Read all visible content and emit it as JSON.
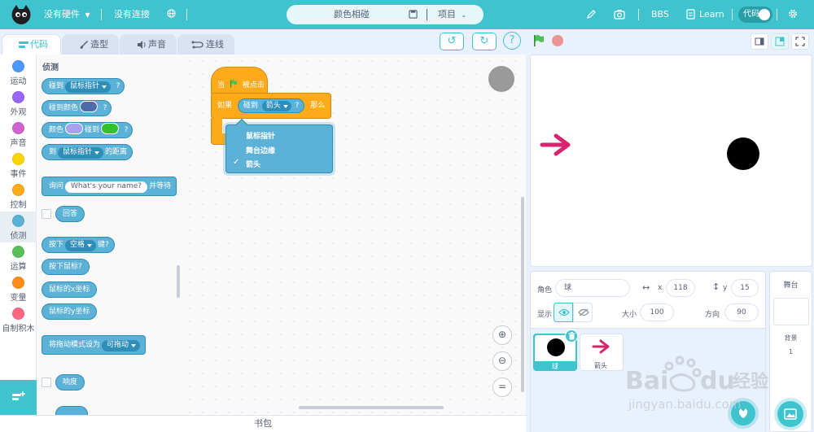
{
  "topbar": {
    "hardware": "没有硬件",
    "connection": "没有连接",
    "project_title": "颜色相碰",
    "project_menu": "项目",
    "bbs": "BBS",
    "learn": "Learn",
    "code_toggle": "代码"
  },
  "tabs": {
    "code": "代码",
    "costume": "造型",
    "sound": "声音",
    "connect": "连线"
  },
  "categories": [
    {
      "label": "运动",
      "color": "#4c97ff"
    },
    {
      "label": "外观",
      "color": "#9966ff"
    },
    {
      "label": "声音",
      "color": "#cf63cf"
    },
    {
      "label": "事件",
      "color": "#ffd500"
    },
    {
      "label": "控制",
      "color": "#ffab19"
    },
    {
      "label": "侦测",
      "color": "#5cb1d6"
    },
    {
      "label": "运算",
      "color": "#59c059"
    },
    {
      "label": "变量",
      "color": "#ff8c1a"
    },
    {
      "label": "自制积木",
      "color": "#ff6680"
    }
  ],
  "palette": {
    "title": "侦测",
    "touching": "碰到",
    "mouse_pointer": "鼠标指针",
    "touching_color": "碰到颜色",
    "color": "颜色",
    "touches": "碰到",
    "to": "到",
    "distance": "的距离",
    "ask": "询问",
    "ask_default": "What's your name?",
    "and_wait": "并等待",
    "answer": "回答",
    "key_press": "按下",
    "space": "空格",
    "key": "键?",
    "mouse_down": "按下鼠标?",
    "mouse_x": "鼠标的x坐标",
    "mouse_y": "鼠标的y坐标",
    "drag_mode": "将拖动模式设为",
    "draggable": "可拖动",
    "loudness": "响度",
    "question_mark": "?"
  },
  "script": {
    "when": "当",
    "clicked": "被点击",
    "if": "如果",
    "touching": "碰到",
    "target": "箭头",
    "question_mark": "?",
    "then": "那么"
  },
  "dropdown": {
    "options": [
      "鼠标指针",
      "舞台边缘",
      "箭头"
    ],
    "selected": "✓"
  },
  "backpack": "书包",
  "sprite_info": {
    "sprite_label": "角色",
    "sprite_name": "球",
    "x_label": "x",
    "x": "118",
    "y_label": "y",
    "y": "15",
    "show_label": "显示",
    "size_label": "大小",
    "size": "100",
    "direction_label": "方向",
    "direction": "90"
  },
  "sprites": [
    {
      "name": "球"
    },
    {
      "name": "箭头"
    }
  ],
  "stage_pane": {
    "title": "舞台",
    "backdrop_label": "背景",
    "backdrop_count": "1"
  },
  "colors": {
    "accent": "#3fc4cf",
    "sensing": "#5cb1d6",
    "control": "#ffab19",
    "arrow": "#d6246e"
  }
}
